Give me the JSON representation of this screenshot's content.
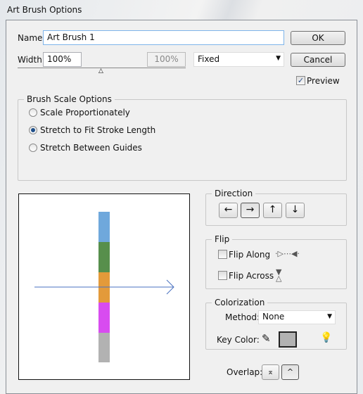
{
  "window": {
    "title": "Art Brush Options"
  },
  "name": {
    "label": "Name:",
    "value": "Art Brush 1"
  },
  "width": {
    "label": "Width:",
    "value": "100%",
    "variation_value": "100%",
    "mode": "Fixed",
    "slider_percent": 100
  },
  "buttons": {
    "ok": "OK",
    "cancel": "Cancel"
  },
  "preview": {
    "label": "Preview",
    "checked": true
  },
  "brush_scale": {
    "title": "Brush Scale Options",
    "options": [
      "Scale Proportionately",
      "Stretch to Fit Stroke Length",
      "Stretch Between Guides"
    ],
    "selected": 1
  },
  "preview_area": {
    "segment_colors": [
      "#6fa8dc",
      "#578f4c",
      "#e39a3a",
      "#d84cf0",
      "#b2b2b2"
    ],
    "arrow_color": "#4a72c0"
  },
  "direction": {
    "title": "Direction",
    "buttons": [
      "←",
      "→",
      "↑",
      "↓"
    ],
    "selected": 1
  },
  "flip": {
    "title": "Flip",
    "along": "Flip Along",
    "across": "Flip Across",
    "along_checked": false,
    "across_checked": false
  },
  "colorization": {
    "title": "Colorization",
    "method_label": "Method:",
    "method_value": "None",
    "key_color_label": "Key Color:",
    "key_color": "#b2b2b2"
  },
  "overlap": {
    "label": "Overlap:"
  }
}
